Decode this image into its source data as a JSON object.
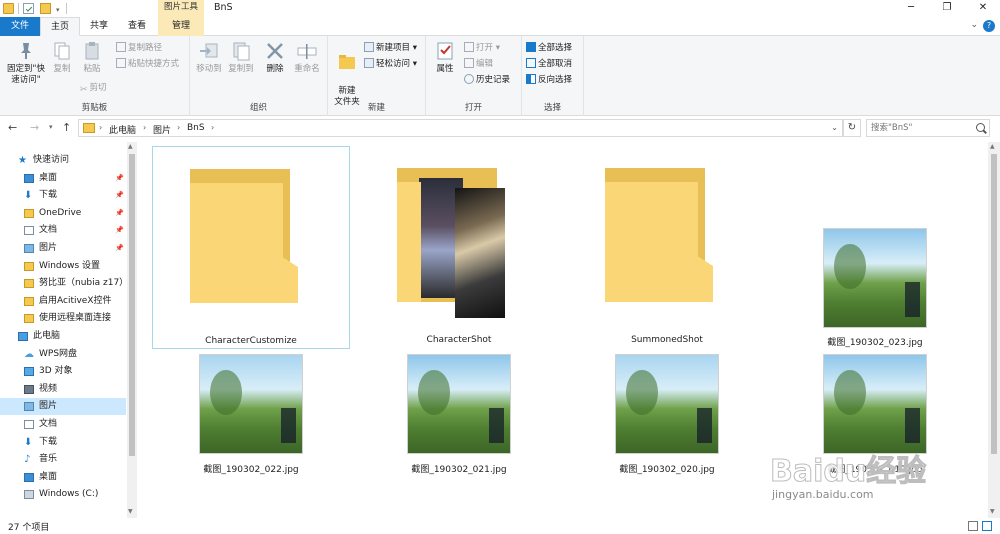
{
  "titlebar": {
    "title": "BnS",
    "context_tab": "图片工具",
    "min_glyph": "─",
    "max_glyph": "❐",
    "close_glyph": "✕"
  },
  "ribbon_tabs": [
    "文件",
    "主页",
    "共享",
    "查看",
    "管理"
  ],
  "ribbon": {
    "clipboard": {
      "label": "剪贴板",
      "pin": "固定到\"快速访问\"",
      "copy": "复制",
      "paste": "粘贴",
      "copy_path": "复制路径",
      "paste_shortcut": "粘贴快捷方式",
      "cut": "剪切"
    },
    "organize": {
      "label": "组织",
      "move_to": "移动到",
      "copy_to": "复制到",
      "delete": "删除",
      "rename": "重命名"
    },
    "new": {
      "label": "新建",
      "new_folder": "新建\n文件夹",
      "new_item": "新建项目",
      "easy_access": "轻松访问"
    },
    "open": {
      "label": "打开",
      "properties": "属性",
      "open": "打开",
      "edit": "编辑",
      "history": "历史记录"
    },
    "select": {
      "label": "选择",
      "select_all": "全部选择",
      "select_none": "全部取消",
      "invert": "反向选择"
    }
  },
  "address": {
    "crumbs": [
      "此电脑",
      "图片",
      "BnS"
    ],
    "search_placeholder": "搜索\"BnS\""
  },
  "navpane": {
    "items": [
      {
        "label": "快速访问",
        "icon": "star-icon",
        "indent": 0,
        "pinned": false
      },
      {
        "label": "桌面",
        "icon": "desktop-icon",
        "indent": 1,
        "pinned": true
      },
      {
        "label": "下载",
        "icon": "download-icon",
        "indent": 1,
        "pinned": true
      },
      {
        "label": "OneDrive",
        "icon": "folder-icon",
        "indent": 1,
        "pinned": true
      },
      {
        "label": "文档",
        "icon": "document-icon",
        "indent": 1,
        "pinned": true
      },
      {
        "label": "图片",
        "icon": "pictures-icon",
        "indent": 1,
        "pinned": true
      },
      {
        "label": "Windows 设置",
        "icon": "folder-icon",
        "indent": 1,
        "pinned": false
      },
      {
        "label": "努比亚（nubia z17）",
        "icon": "folder-icon",
        "indent": 1,
        "pinned": false
      },
      {
        "label": "启用AcitiveX控件",
        "icon": "folder-icon",
        "indent": 1,
        "pinned": false
      },
      {
        "label": "使用远程桌面连接",
        "icon": "folder-icon",
        "indent": 1,
        "pinned": false
      },
      {
        "label": "此电脑",
        "icon": "computer-icon",
        "indent": 0,
        "pinned": false
      },
      {
        "label": "WPS网盘",
        "icon": "cloud-icon",
        "indent": 1,
        "pinned": false
      },
      {
        "label": "3D 对象",
        "icon": "cube-icon",
        "indent": 1,
        "pinned": false
      },
      {
        "label": "视频",
        "icon": "video-icon",
        "indent": 1,
        "pinned": false
      },
      {
        "label": "图片",
        "icon": "pictures-icon",
        "indent": 1,
        "pinned": false,
        "selected": true
      },
      {
        "label": "文档",
        "icon": "document-icon",
        "indent": 1,
        "pinned": false
      },
      {
        "label": "下载",
        "icon": "download-icon",
        "indent": 1,
        "pinned": false
      },
      {
        "label": "音乐",
        "icon": "music-icon",
        "indent": 1,
        "pinned": false
      },
      {
        "label": "桌面",
        "icon": "desktop-icon",
        "indent": 1,
        "pinned": false
      },
      {
        "label": "Windows (C:)",
        "icon": "drive-icon",
        "indent": 1,
        "pinned": false
      }
    ]
  },
  "files": [
    {
      "name": "CharacterCustomize",
      "kind": "folder",
      "selected": true
    },
    {
      "name": "CharacterShot",
      "kind": "folder-with-image"
    },
    {
      "name": "SummonedShot",
      "kind": "folder"
    },
    {
      "name": "截图_190302_023.jpg",
      "kind": "image"
    },
    {
      "name": "截图_190302_022.jpg",
      "kind": "image"
    },
    {
      "name": "截图_190302_021.jpg",
      "kind": "image"
    },
    {
      "name": "截图_190302_020.jpg",
      "kind": "image"
    },
    {
      "name": "截图_190302_019.jpg",
      "kind": "image"
    }
  ],
  "status": {
    "item_count": "27 个项目"
  },
  "watermark": {
    "line1": "Baidu经验",
    "line2": "jingyan.baidu.com"
  },
  "colors": {
    "accent": "#1979ca",
    "selected_bg": "#cce8ff",
    "folder_front": "#fbd676",
    "folder_back": "#e8bf55",
    "context_tab": "#fbe9b8"
  }
}
